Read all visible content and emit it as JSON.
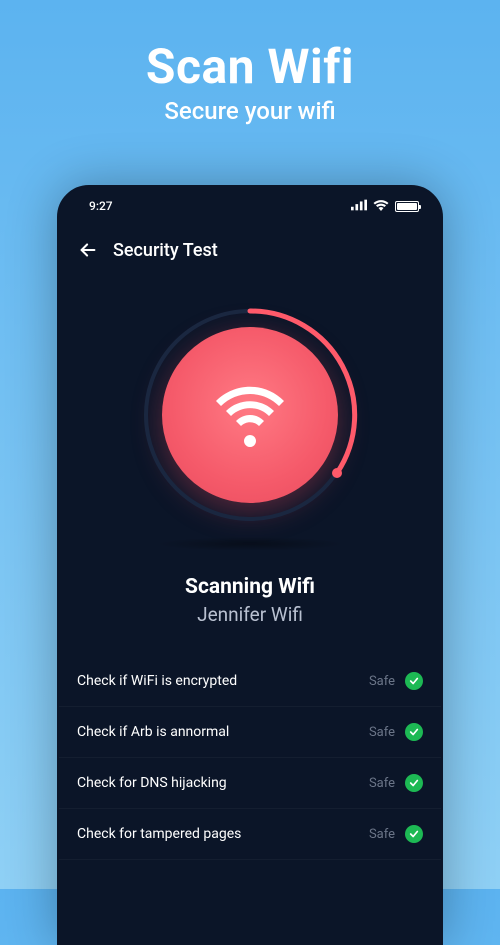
{
  "promo": {
    "title": "Scan Wifi",
    "subtitle": "Secure your wifi"
  },
  "statusBar": {
    "time": "9:27"
  },
  "header": {
    "title": "Security Test"
  },
  "scan": {
    "title": "Scanning Wifi",
    "network": "Jennifer Wifi"
  },
  "checks": [
    {
      "label": "Check if WiFi is encrypted",
      "status": "Safe"
    },
    {
      "label": "Check if Arb is annormal",
      "status": "Safe"
    },
    {
      "label": "Check for DNS hijacking",
      "status": "Safe"
    },
    {
      "label": "Check for tampered pages",
      "status": "Safe"
    }
  ]
}
